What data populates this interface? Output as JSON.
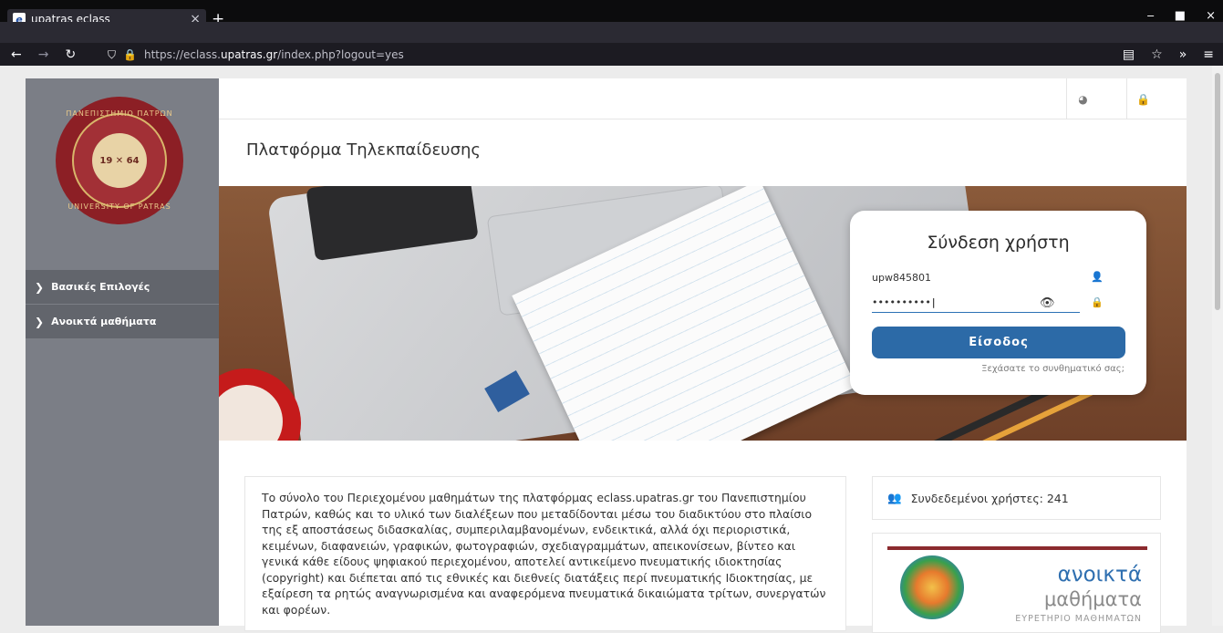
{
  "browser": {
    "tab_title": "upatras eclass",
    "tab_close": "×",
    "new_tab": "+",
    "url_prefix": "https://eclass.",
    "url_domain": "upatras.gr",
    "url_rest": "/index.php?logout=yes",
    "window_minimize": "‒",
    "window_maximize": "■",
    "window_close": "×"
  },
  "sidebar": {
    "logo_top_text": "ΠΑΝΕΠΙΣΤΗΜΙΟ ΠΑΤΡΩΝ",
    "logo_bottom_text": "UNIVERSITY OF PATRAS",
    "logo_year_left": "19",
    "logo_year_right": "64",
    "items": [
      {
        "label": "Βασικές Επιλογές"
      },
      {
        "label": "Ανοικτά μαθήματα"
      }
    ]
  },
  "header": {
    "title": "Πλατφόρμα Τηλεκπαίδευσης"
  },
  "login": {
    "title": "Σύνδεση χρήστη",
    "username_value": "upw845801",
    "password_value": "••••••••••",
    "submit_label": "Είσοδος",
    "forgot_link": "Ξεχάσατε το συνθηματικό σας;"
  },
  "content": {
    "paragraph": "Το σύνολο του Περιεχομένου μαθημάτων της πλατφόρμας eclass.upatras.gr του Πανεπιστημίου Πατρών, καθώς και το υλικό των διαλέξεων που μεταδίδονται μέσω του διαδικτύου στο πλαίσιο της εξ αποστάσεως διδασκαλίας, συμπεριλαμβανομένων, ενδεικτικά, αλλά όχι περιοριστικά, κειμένων, διαφανειών, γραφικών, φωτογραφιών, σχεδιαγραμμάτων, απεικονίσεων, βίντεο και γενικά κάθε είδους ψηφιακού περιεχομένου, αποτελεί αντικείμενο πνευματικής ιδιοκτησίας (copyright) και διέπεται από τις εθνικές και διεθνείς διατάξεις περί πνευματικής Ιδιοκτησίας, με εξαίρεση τα ρητώς αναγνωρισμένα και αναφερόμενα πνευματικά δικαιώματα τρίτων, συνεργατών και φορέων."
  },
  "online_users": {
    "label": "Συνδεδεμένοι χρήστες: 241"
  },
  "open_courses": {
    "word1": "ανοικτά",
    "word2": "μαθήματα",
    "subtitle": "ΕΥΡΕΤΗΡΙΟ ΜΑΘΗΜΑΤΩΝ"
  }
}
